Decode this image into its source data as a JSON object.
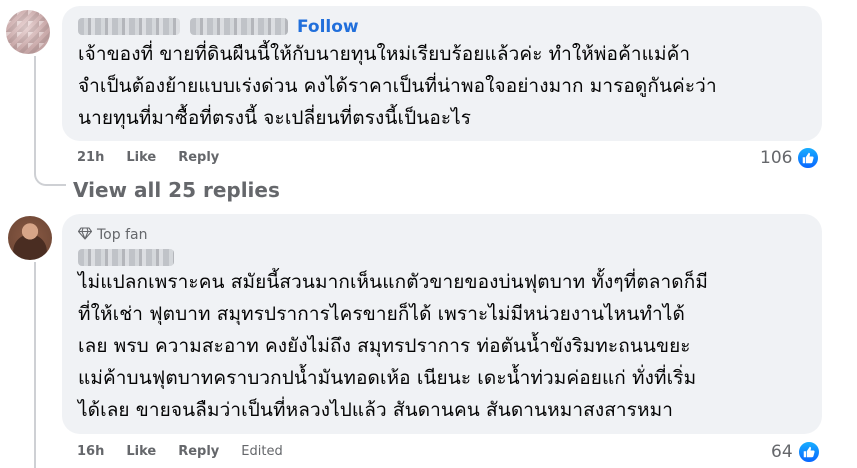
{
  "comment1": {
    "follow_label": "Follow",
    "text": "เจ้าของที่ ขายที่ดินผืนนี้ให้กับนายทุนใหม่เรียบร้อยแล้วค่ะ ทำให้พ่อค้าแม่ค้า\nจำเป็นต้องย้ายแบบเร่งด่วน คงได้ราคาเป็นที่น่าพอใจอย่างมาก มารอดูกันค่ะว่า\nนายทุนที่มาซื้อที่ตรงนี้ จะเปลี่ยนที่ตรงนี้เป็นอะไร",
    "time": "21h",
    "like_label": "Like",
    "reply_label": "Reply",
    "reaction_count": "106",
    "reaction_icon": "like-icon"
  },
  "view_replies_label": "View all 25 replies",
  "comment2": {
    "badge_label": "Top fan",
    "badge_icon": "diamond-icon",
    "text": "ไม่แปลกเพราะคน สมัยนี้สวนมากเห็นแกตัวขายของบ่นฟุตบาท ทั้งๆที่ตลาดก็มี\nที่ให้เช่า ฟุตบาท สมุทรปราการไครขายก็ได้ เพราะไม่มีหน่วยงานไหนทำได้\nเลย พรบ ความสะอาท คงยังไม่ถึง สมุทรปราการ ท่อตันน้ำขังริมทะถนนขยะ\nแม่ค้าบนฟุตบาทคราบวกปน้ำมันทอดเห้อ เนียนะ เดะน้ำท่วมค่อยแก่ ทั่งที่เริ่ม\nได้เลย ขายจนลืมว่าเป็นที่หลวงไปแล้ว สันดานคน สันดานหมาสงสารหมา",
    "time": "16h",
    "like_label": "Like",
    "reply_label": "Reply",
    "edited_label": "Edited",
    "reaction_count": "64",
    "reaction_icon": "like-icon"
  },
  "colors": {
    "bubble": "#f0f2f5",
    "link": "#216fdb",
    "muted": "#65676b",
    "like_blue": "#0866ff"
  }
}
